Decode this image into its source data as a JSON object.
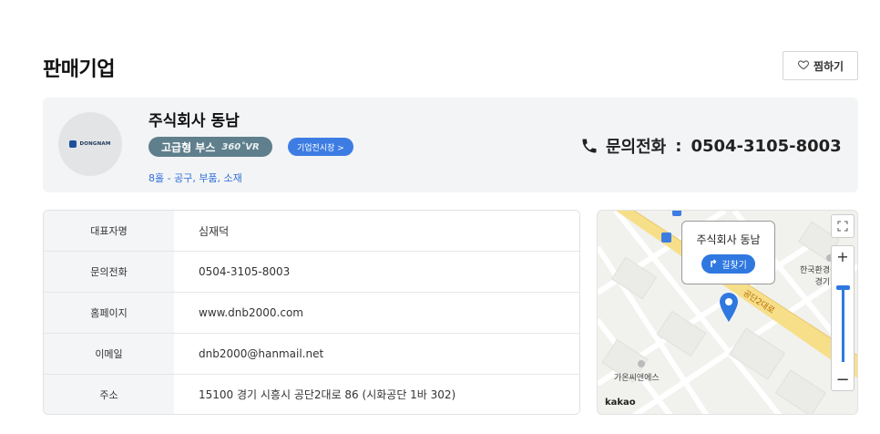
{
  "section": {
    "title": "판매기업",
    "favorite_label": "찜하기"
  },
  "company": {
    "logo_text": "DONGNAM",
    "name": "주식회사 동남",
    "booth_badge": "고급형 부스",
    "booth_vr": "360˚VR",
    "exhibit_link": "기업전시장 >",
    "hall": "8홀 - 공구, 부품, 소재",
    "phone_label": "문의전화",
    "phone_sep": ":",
    "phone_number": "0504-3105-8003"
  },
  "info_table": {
    "rows": [
      {
        "label": "대표자명",
        "value": "심재덕"
      },
      {
        "label": "문의전화",
        "value": "0504-3105-8003"
      },
      {
        "label": "홈페이지",
        "value": "www.dnb2000.com"
      },
      {
        "label": "이메일",
        "value": "dnb2000@hanmail.net"
      },
      {
        "label": "주소",
        "value": "15100 경기 시흥시 공단2대로 86 (시화공단 1바 302)"
      }
    ]
  },
  "map": {
    "popup_name": "주식회사 동남",
    "route_label": "길찾기",
    "road_label": "공단2대로",
    "poi_1_line1": "한국환경공단",
    "poi_1_line2": "경기지사",
    "poi_2": "가온씨앤에스",
    "logo": "kakao",
    "zoom_in": "+",
    "zoom_out": "−"
  },
  "colors": {
    "accent_blue": "#2f78e0",
    "booth_badge_bg": "#5f7f8c",
    "card_bg": "#f3f4f6",
    "road_yellow": "#f7df8a"
  }
}
